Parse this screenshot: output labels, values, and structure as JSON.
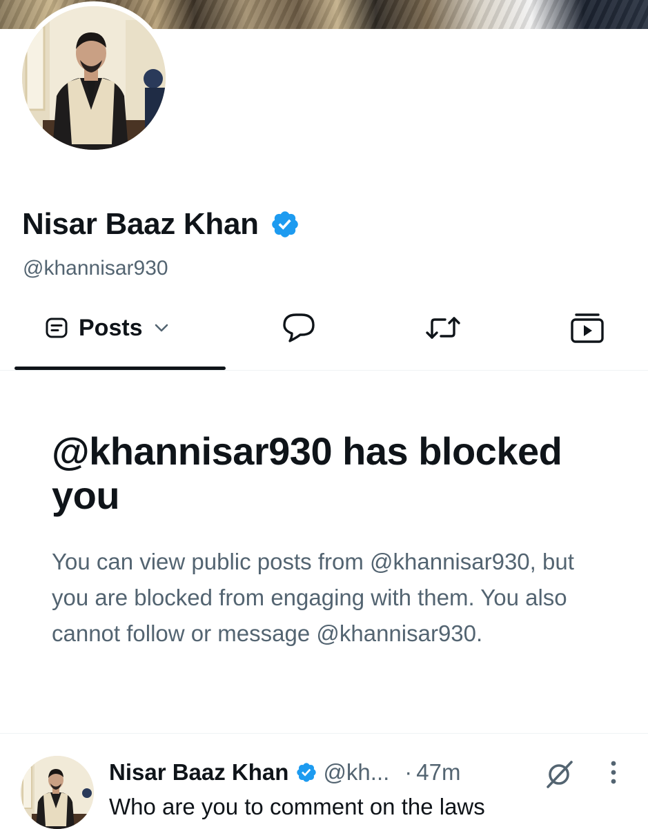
{
  "profile": {
    "display_name": "Nisar Baaz Khan",
    "handle": "@khannisar930",
    "verified_color": "#1d9bf0"
  },
  "tabs": [
    {
      "label": "Posts",
      "icon": "posts-icon",
      "selected": true,
      "has_dropdown": true
    },
    {
      "label": "",
      "icon": "reply-bubble-icon"
    },
    {
      "label": "",
      "icon": "repost-icon"
    },
    {
      "label": "",
      "icon": "media-icon"
    }
  ],
  "blocked_notice": {
    "title": "@khannisar930 has blocked you",
    "description": "You can view public posts from @khannisar930, but you are blocked from engaging with them. You also cannot follow or message @khannisar930."
  },
  "post": {
    "author_name": "Nisar Baaz Khan",
    "author_handle": "@kh...",
    "separator": "·",
    "time": "47m",
    "text": "Who are you to comment on the laws",
    "icons": [
      "grok-icon",
      "more-vertical-icon"
    ]
  },
  "colors": {
    "text_primary": "#0f1419",
    "text_secondary": "#536471",
    "accent": "#1d9bf0",
    "divider": "#eff3f4"
  }
}
